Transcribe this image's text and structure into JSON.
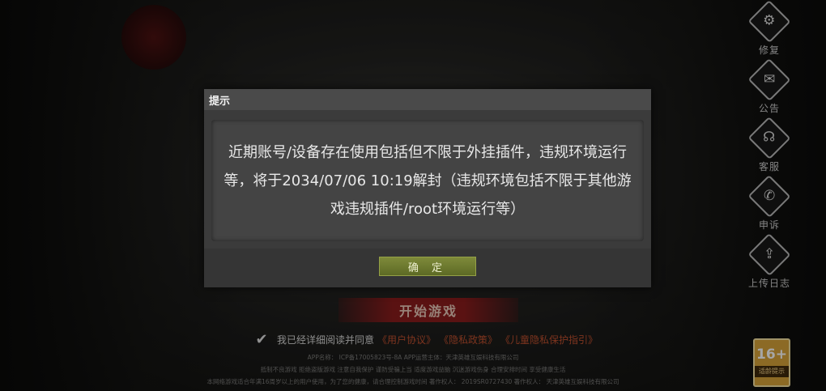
{
  "side_menu": [
    {
      "icon": "gear-icon",
      "glyph": "⚙",
      "label": "修复"
    },
    {
      "icon": "notice-icon",
      "glyph": "✉",
      "label": "公告"
    },
    {
      "icon": "headset-icon",
      "glyph": "☊",
      "label": "客服"
    },
    {
      "icon": "phone-icon",
      "glyph": "✆",
      "label": "申诉"
    },
    {
      "icon": "upload-icon",
      "glyph": "⇪",
      "label": "上传日志"
    }
  ],
  "start_button": "开始游戏",
  "agreement": {
    "prefix": "我已经详细阅读并同意",
    "link1": "《用户协议》",
    "link2": "《隐私政策》",
    "link3": "《儿童隐私保护指引》"
  },
  "legal": {
    "line1": "APP名称：    ICP备17005823号-8A    APP运营主体：天津英雄互娱科技有限公司",
    "line2": "抵制不良游戏 拒绝盗版游戏 注意自我保护 谨防受骗上当 适度游戏益脑 沉迷游戏伤身 合理安排时间 享受健康生活",
    "line3": "本网络游戏适合年满16周岁以上的用户使用，为了您的健康，请合理控制游戏时间    著作权人：    2019SR0727430    著作权人：    天津英雄互娱科技有限公司"
  },
  "age_badge": {
    "rating": "16+",
    "label": "适龄提示"
  },
  "dialog": {
    "title": "提示",
    "message": "近期账号/设备存在使用包括但不限于外挂插件，违规环境运行等，将于2034/07/06 10:19解封（违规环境包括不限于其他游戏违规插件/root环境运行等）",
    "confirm": "确 定"
  },
  "colors": {
    "accent_red": "#8a1c1c",
    "link_red": "#c1502e",
    "confirm_green": "#6e7a30",
    "age_gold": "#d7a43a"
  }
}
